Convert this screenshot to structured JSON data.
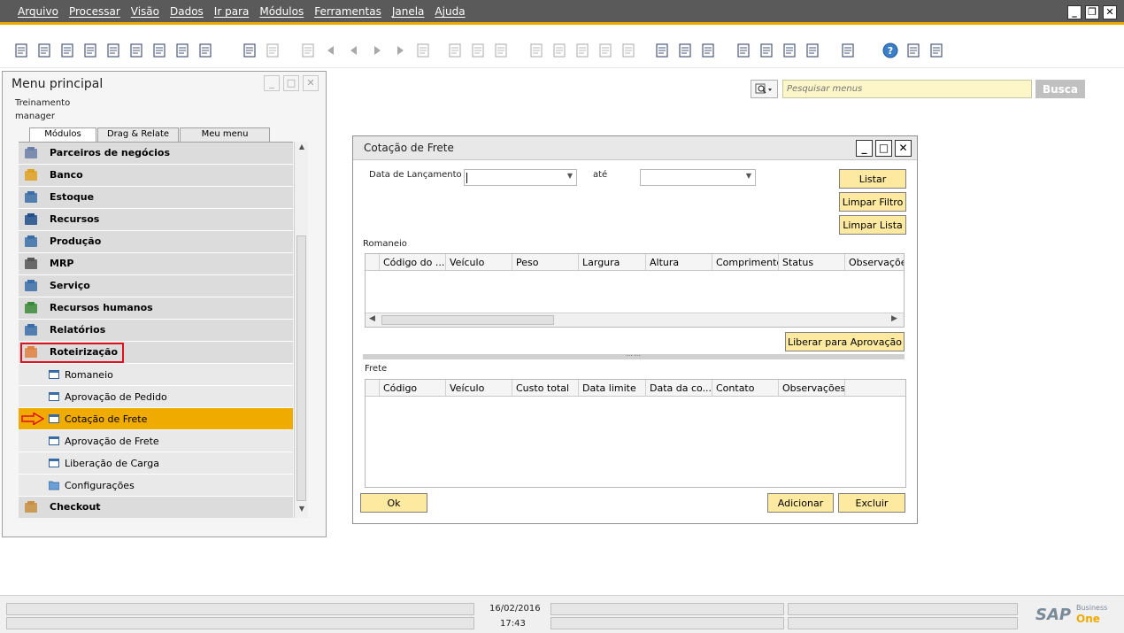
{
  "menubar": {
    "items": [
      "Arquivo",
      "Processar",
      "Visão",
      "Dados",
      "Ir para",
      "Módulos",
      "Ferramentas",
      "Janela",
      "Ajuda"
    ]
  },
  "toolbar": {
    "icons": [
      "print-preview-icon",
      "print-icon",
      "email-icon",
      "export-icon",
      "calculator-icon",
      "excel-icon",
      "word-icon",
      "pdf-icon",
      "launch-icon",
      "lock-icon",
      "find-icon",
      "add-icon",
      "first-record-icon",
      "previous-record-icon",
      "next-record-icon",
      "last-record-icon",
      "refresh-icon",
      "filter-icon",
      "sort-icon",
      "base-document-icon",
      "target-document-icon",
      "report-icon",
      "settings-icon",
      "chart-icon",
      "payment-icon",
      "check-icon",
      "pen-icon",
      "document-settings-icon",
      "document-edit-icon",
      "calendar-icon",
      "alert-icon",
      "message-icon",
      "organization-icon",
      "help-icon",
      "form-settings-icon",
      "user-defined-icon"
    ]
  },
  "main_menu": {
    "title": "Menu principal",
    "user_line1": "Treinamento",
    "user_line2": "manager",
    "tabs": [
      "Módulos",
      "Drag & Relate",
      "Meu menu"
    ],
    "modules": [
      {
        "label": "Parceiros de negócios",
        "icon": "business-partners-icon",
        "color": "#6c7fa8"
      },
      {
        "label": "Banco",
        "icon": "bank-icon",
        "color": "#e0a020"
      },
      {
        "label": "Estoque",
        "icon": "inventory-icon",
        "color": "#3a6ea8"
      },
      {
        "label": "Recursos",
        "icon": "resources-icon",
        "color": "#1f4e8a"
      },
      {
        "label": "Produção",
        "icon": "production-icon",
        "color": "#3a6ea8"
      },
      {
        "label": "MRP",
        "icon": "mrp-icon",
        "color": "#555555"
      },
      {
        "label": "Serviço",
        "icon": "service-icon",
        "color": "#3a6ea8"
      },
      {
        "label": "Recursos humanos",
        "icon": "human-resources-icon",
        "color": "#3a8a3a"
      },
      {
        "label": "Relatórios",
        "icon": "reports-icon",
        "color": "#3a6ea8"
      },
      {
        "label": "Roteirização",
        "icon": "routing-icon",
        "color": "#e08040",
        "highlighted": true
      }
    ],
    "sub_items": [
      {
        "label": "Romaneio",
        "icon": "form-icon"
      },
      {
        "label": "Aprovação de Pedido",
        "icon": "form-icon"
      },
      {
        "label": "Cotação de Frete",
        "icon": "form-icon",
        "selected": true
      },
      {
        "label": "Aprovação de Frete",
        "icon": "form-icon"
      },
      {
        "label": "Liberação de Carga",
        "icon": "form-icon"
      },
      {
        "label": "Configurações",
        "icon": "folder-icon"
      }
    ],
    "last_module": {
      "label": "Checkout",
      "icon": "checkout-icon",
      "color": "#c89040"
    }
  },
  "search": {
    "placeholder": "Pesquisar menus",
    "button": "Busca"
  },
  "dialog": {
    "title": "Cotação de Frete",
    "date_label": "Data de Lançamento",
    "until_label": "até",
    "buttons": {
      "listar": "Listar",
      "limpar_filtro": "Limpar Filtro",
      "limpar_lista": "Limpar Lista",
      "liberar": "Liberar para Aprovação",
      "ok": "Ok",
      "adicionar": "Adicionar",
      "excluir": "Excluir"
    },
    "romaneio": {
      "title": "Romaneio",
      "columns": [
        "Código do ...",
        "Veículo",
        "Peso",
        "Largura",
        "Altura",
        "Comprimento",
        "Status",
        "Observações"
      ]
    },
    "frete": {
      "title": "Frete",
      "columns": [
        "Código",
        "Veículo",
        "Custo total",
        "Data limite",
        "Data da co...",
        "Contato",
        "Observações"
      ]
    }
  },
  "statusbar": {
    "date": "16/02/2016",
    "time": "17:43",
    "logo": "SAP",
    "logo_sub1": "Business",
    "logo_sub2": "One"
  },
  "colors": {
    "accent": "#f0ab00",
    "menubar_bg": "#5a5a5a",
    "highlight_red": "#e0101e",
    "button_bg": "#fde9a0"
  }
}
